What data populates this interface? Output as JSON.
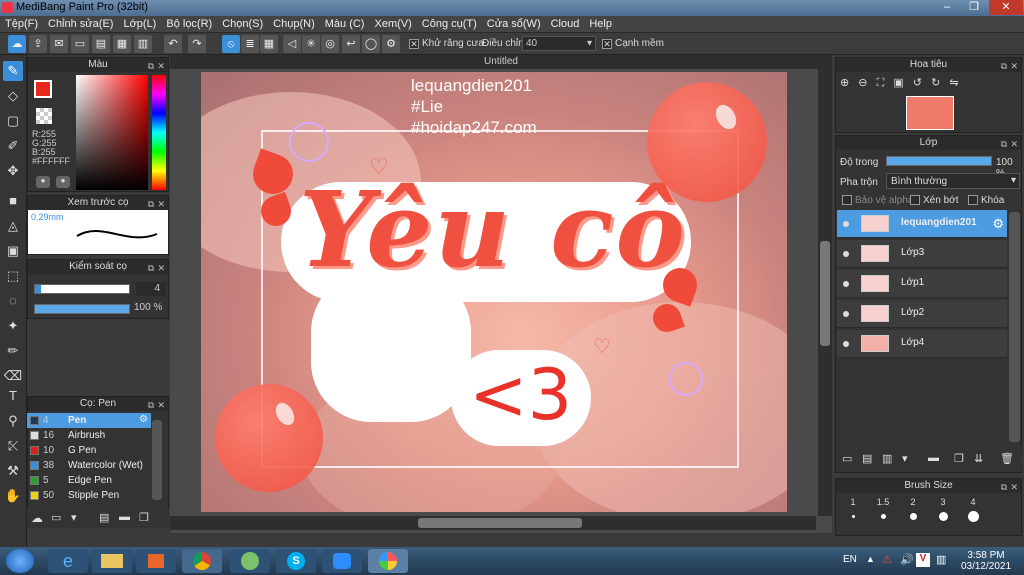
{
  "window": {
    "title": "MediBang Paint Pro (32bit)"
  },
  "menu": [
    "Tệp(F)",
    "Chỉnh sửa(E)",
    "Lớp(L)",
    "Bộ lọc(R)",
    "Chọn(S)",
    "Chụp(N)",
    "Màu (C)",
    "Xem(V)",
    "Công cụ(T)",
    "Cửa sổ(W)",
    "Cloud",
    "Help"
  ],
  "toolbar": {
    "antialias_label": "Khử răng cưa",
    "adjust_label": "Điều chỉnh",
    "adjust_value": "40",
    "sharp_edge_label": "Cạnh mềm"
  },
  "color_panel": {
    "title": "Màu",
    "r": "R:255",
    "g": "G:255",
    "b": "B:255",
    "hex": "#FFFFFF",
    "colors": {
      "fg": "#e8281c",
      "bg": "#ffffff"
    }
  },
  "brush_preview": {
    "title": "Xem trước cọ",
    "size": "0.29mm"
  },
  "brush_control": {
    "title": "Kiểm soát cọ",
    "size_value": "4",
    "opacity_value": "100 %"
  },
  "brush_list": {
    "title": "Cọ: Pen",
    "items": [
      {
        "size": "4",
        "name": "Pen",
        "color": "#1d3a5a"
      },
      {
        "size": "16",
        "name": "Airbrush",
        "color": "#dddddd"
      },
      {
        "size": "10",
        "name": "G Pen",
        "color": "#e02020"
      },
      {
        "size": "38",
        "name": "Watercolor (Wet)",
        "color": "#3a8fe0"
      },
      {
        "size": "5",
        "name": "Edge Pen",
        "color": "#2fa02f"
      },
      {
        "size": "50",
        "name": "Stipple Pen",
        "color": "#e8d21a"
      }
    ]
  },
  "canvas": {
    "tab_title": "Untitled",
    "watermark": [
      "lequangdien201",
      "#Lie",
      "#hoidap247.com"
    ],
    "art_text_main": "Yêu cô",
    "art_text_sub": "<3"
  },
  "navigator": {
    "title": "Hoa tiêu"
  },
  "layers_panel": {
    "title": "Lớp",
    "opacity_label": "Độ trong",
    "opacity_value": "100 %",
    "blend_label": "Pha trộn",
    "blend_value": "Bình thường",
    "protect_alpha": "Bảo vệ alpha",
    "clipping": "Xén bớt",
    "lock": "Khóa",
    "layers": [
      {
        "name": "lequangdien201",
        "selected": true
      },
      {
        "name": "Lớp3",
        "selected": false
      },
      {
        "name": "Lớp1",
        "selected": false
      },
      {
        "name": "Lớp2",
        "selected": false
      },
      {
        "name": "Lớp4",
        "selected": false
      }
    ]
  },
  "brush_size_panel": {
    "title": "Brush Size",
    "sizes": [
      "1",
      "1.5",
      "2",
      "3",
      "4"
    ]
  },
  "taskbar": {
    "lang": "EN",
    "time": "3:58 PM",
    "date": "03/12/2021"
  }
}
